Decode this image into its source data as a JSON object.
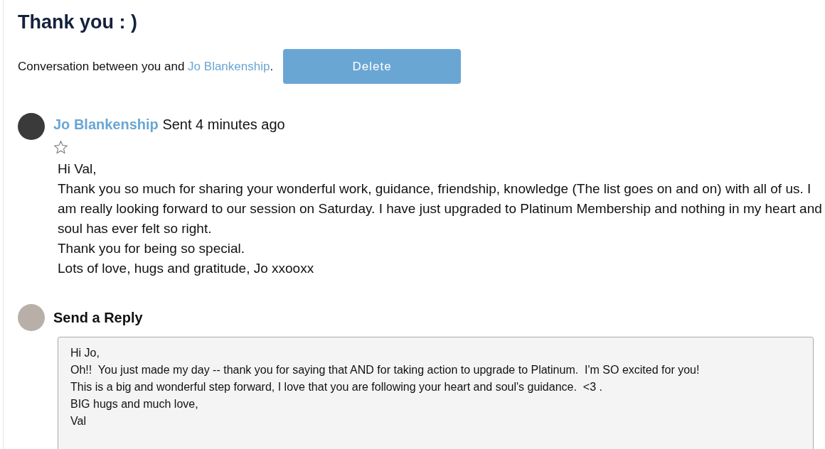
{
  "title": "Thank you : )",
  "conversation": {
    "prefix": "Conversation between you and ",
    "participant": "Jo Blankenship",
    "suffix": ".",
    "delete_button": "Delete"
  },
  "message": {
    "sender": "Jo Blankenship",
    "sent": "Sent 4 minutes ago",
    "starred": false,
    "lines": [
      "Hi Val,",
      "Thank you so much for sharing your wonderful work, guidance, friendship, knowledge (The list goes on and on) with all of us. I am really looking forward to our session on Saturday. I have just upgraded to Platinum Membership and nothing in my heart and soul has ever felt so right.",
      "Thank you for being so special.",
      "Lots of love, hugs and gratitude, Jo xxooxx"
    ]
  },
  "reply": {
    "heading": "Send a Reply",
    "value": "Hi Jo,\nOh!!  You just made my day -- thank you for saying that AND for taking action to upgrade to Platinum.  I'm SO excited for you!\nThis is a big and wonderful step forward, I love that you are following your heart and soul's guidance.  <3 .\nBIG hugs and much love,\nVal"
  }
}
